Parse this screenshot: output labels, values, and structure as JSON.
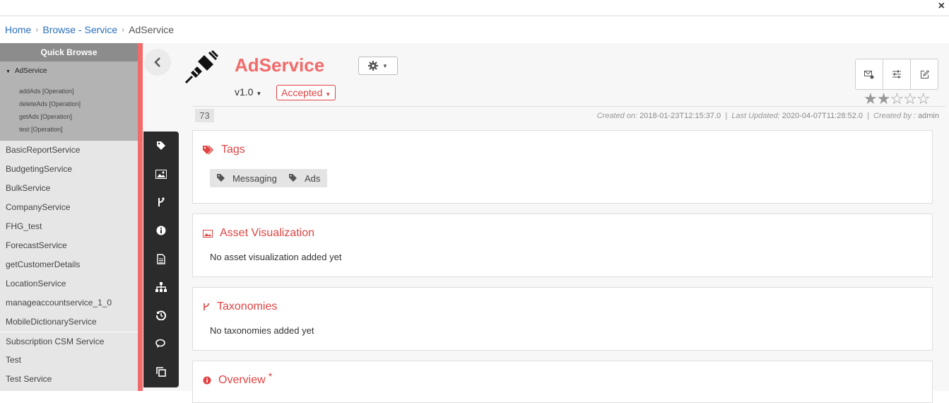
{
  "window": {
    "close_label": "×"
  },
  "breadcrumb": {
    "home": "Home",
    "browse": "Browse - Service",
    "current": "AdService",
    "sep": "›"
  },
  "quick_browse": {
    "title": "Quick Browse",
    "current": "AdService",
    "operations": [
      "addAds [Operation]",
      "deleteAds [Operation]",
      "getAds [Operation]",
      "test [Operation]"
    ],
    "items": [
      "BasicReportService",
      "BudgetingService",
      "BulkService",
      "CompanyService",
      "FHG_test",
      "ForecastService",
      "getCustomerDetails",
      "LocationService",
      "manageaccountservice_1_0",
      "MobileDictionaryService",
      "Subscription CSM Service",
      "Test",
      "Test Service"
    ]
  },
  "sidebar_icons": [
    "tag-icon",
    "image-icon",
    "taxonomy-icon",
    "info-icon",
    "document-icon",
    "hierarchy-icon",
    "history-icon",
    "comments-icon",
    "copy-icon"
  ],
  "asset": {
    "name": "AdService",
    "version": "v1.0",
    "status": "Accepted",
    "rating": 2,
    "count": "73",
    "created_label": "Created on:",
    "created": "2018-01-23T12:15:37.0",
    "updated_label": "Last Updated:",
    "updated": "2020-04-07T11:28:52.0",
    "created_by_label": "Created by :",
    "created_by": "admin"
  },
  "sections": {
    "tags": {
      "title": "Tags",
      "items": [
        "Messaging",
        "Ads"
      ]
    },
    "visualization": {
      "title": "Asset Visualization",
      "empty": "No asset visualization added yet"
    },
    "taxonomies": {
      "title": "Taxonomies",
      "empty": "No taxonomies added yet"
    },
    "overview": {
      "title": "Overview",
      "required": "*"
    }
  },
  "colors": {
    "accent": "#f26b6b",
    "status": "#e04444",
    "sidebar": "#2b2b2b"
  }
}
